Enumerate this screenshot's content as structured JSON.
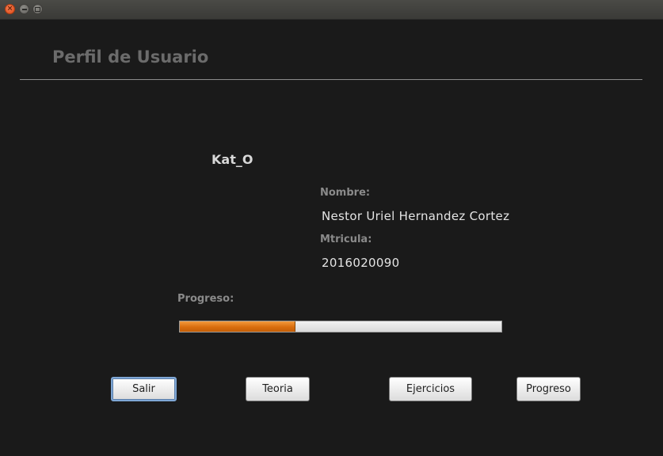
{
  "window": {
    "controls": {
      "close_icon": "close-icon",
      "minimize_icon": "minimize-icon",
      "maximize_icon": "maximize-icon"
    }
  },
  "header": {
    "title": "Perfil de Usuario"
  },
  "profile": {
    "username": "Kat_O",
    "name_label": "Nombre:",
    "name_value": "Nestor Uriel Hernandez Cortez",
    "matricula_label": "Mtricula:",
    "matricula_value": "2016020090"
  },
  "progress": {
    "label": "Progreso:",
    "fraction": 0.36,
    "fill_color": "#d96d0e"
  },
  "buttons": {
    "salir": "Salir",
    "teoria": "Teoria",
    "ejercicios": "Ejercicios",
    "progreso": "Progreso"
  }
}
